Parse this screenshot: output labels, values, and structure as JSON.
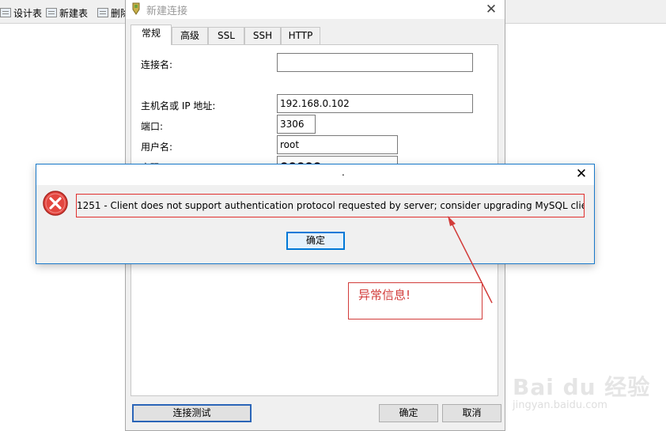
{
  "app_toolbar": {
    "items": [
      {
        "label": "设计表",
        "icon": "design-table-icon"
      },
      {
        "label": "新建表",
        "icon": "new-table-icon"
      },
      {
        "label": "删除",
        "icon": "delete-table-icon"
      }
    ]
  },
  "connection_window": {
    "title": "新建连接",
    "tabs": [
      "常规",
      "高级",
      "SSL",
      "SSH",
      "HTTP"
    ],
    "active_tab": "常规",
    "fields": {
      "connection_name": {
        "label": "连接名:",
        "value": ""
      },
      "host": {
        "label": "主机名或 IP 地址:",
        "value": "192.168.0.102"
      },
      "port": {
        "label": "端口:",
        "value": "3306"
      },
      "username": {
        "label": "用户名:",
        "value": "root"
      },
      "password": {
        "label": "密码",
        "value": "●●●●●"
      }
    },
    "buttons": {
      "test": "连接测试",
      "ok": "确定",
      "cancel": "取消"
    }
  },
  "error_dialog": {
    "title": ".",
    "message": "1251 - Client does not support authentication protocol requested by server; consider upgrading MySQL client",
    "ok_label": "确定",
    "icon": "error-icon"
  },
  "annotation": {
    "text": "异常信息!",
    "color": "#d23c3a"
  },
  "watermark": {
    "logo": "Bai du 经验",
    "url": "jingyan.baidu.com"
  },
  "colors": {
    "accent": "#0078d7",
    "error_red": "#e0302e"
  }
}
